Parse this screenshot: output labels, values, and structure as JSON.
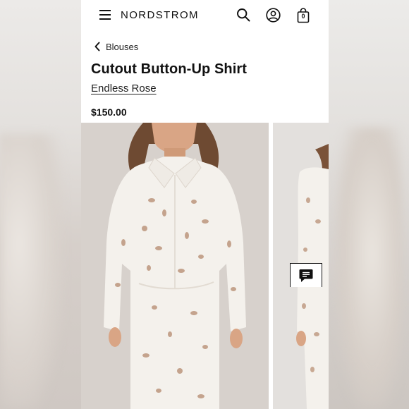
{
  "header": {
    "brand": "NORDSTROM",
    "icons": [
      "menu-icon",
      "search-icon",
      "account-icon",
      "shopping-bag-icon"
    ],
    "bag_count": "0"
  },
  "breadcrumb": {
    "label": "Blouses"
  },
  "product": {
    "title": "Cutout Button-Up Shirt",
    "brand": "Endless Rose",
    "price": "$150.00"
  },
  "gallery": {
    "images": [
      "model-front-photo",
      "model-side-photo"
    ]
  },
  "chat": {
    "icon": "chat-icon"
  },
  "colors": {
    "text": "#111111",
    "garment": "#f4f1ec",
    "background": "#ffffff"
  }
}
